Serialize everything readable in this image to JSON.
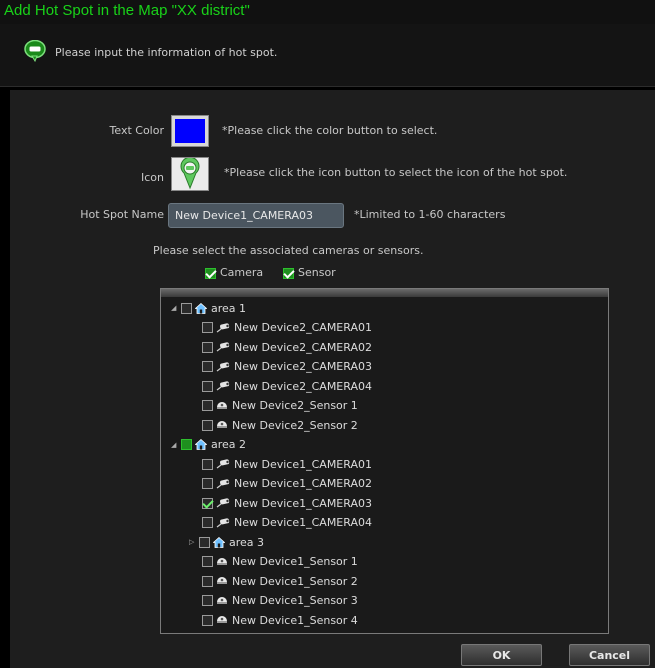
{
  "window": {
    "title": "Add Hot Spot in the Map \"XX district\""
  },
  "hint": {
    "text": "Please input the information of hot spot."
  },
  "form": {
    "text_color": {
      "label": "Text Color",
      "note": "*Please click the color button to select.",
      "value": "#0000ff"
    },
    "icon": {
      "label": "Icon",
      "note": "*Please click the icon button to select the icon of the hot spot."
    },
    "hot_spot_name": {
      "label": "Hot Spot Name",
      "value": "New Device1_CAMERA03",
      "note": "*Limited to 1-60 characters"
    },
    "assoc_prompt": "Please select the associated cameras or sensors.",
    "filters": [
      {
        "label": "Camera",
        "checked": true
      },
      {
        "label": "Sensor",
        "checked": true
      }
    ]
  },
  "tree": [
    {
      "label": "area 1",
      "type": "area",
      "level": 0,
      "expander": "expanded",
      "checked": false
    },
    {
      "label": "New Device2_CAMERA01",
      "type": "camera",
      "level": 1,
      "checked": false
    },
    {
      "label": "New Device2_CAMERA02",
      "type": "camera",
      "level": 1,
      "checked": false
    },
    {
      "label": "New Device2_CAMERA03",
      "type": "camera",
      "level": 1,
      "checked": false
    },
    {
      "label": "New Device2_CAMERA04",
      "type": "camera",
      "level": 1,
      "checked": false
    },
    {
      "label": "New Device2_Sensor 1",
      "type": "sensor",
      "level": 1,
      "checked": false
    },
    {
      "label": "New Device2_Sensor 2",
      "type": "sensor",
      "level": 1,
      "checked": false
    },
    {
      "label": "area 2",
      "type": "area",
      "level": 0,
      "expander": "expanded",
      "checked": "partial"
    },
    {
      "label": "New Device1_CAMERA01",
      "type": "camera",
      "level": 1,
      "checked": false
    },
    {
      "label": "New Device1_CAMERA02",
      "type": "camera",
      "level": 1,
      "checked": false
    },
    {
      "label": "New Device1_CAMERA03",
      "type": "camera",
      "level": 1,
      "checked": true
    },
    {
      "label": "New Device1_CAMERA04",
      "type": "camera",
      "level": 1,
      "checked": false
    },
    {
      "label": "area 3",
      "type": "area",
      "level": 1,
      "expander": "collapsed",
      "checked": false
    },
    {
      "label": "New Device1_Sensor 1",
      "type": "sensor",
      "level": 1,
      "checked": false
    },
    {
      "label": "New Device1_Sensor 2",
      "type": "sensor",
      "level": 1,
      "checked": false
    },
    {
      "label": "New Device1_Sensor 3",
      "type": "sensor",
      "level": 1,
      "checked": false
    },
    {
      "label": "New Device1_Sensor 4",
      "type": "sensor",
      "level": 1,
      "checked": false
    }
  ],
  "buttons": {
    "ok": "OK",
    "cancel": "Cancel"
  },
  "icons": {
    "hint": "speech-bubble-icon",
    "hot_spot": "map-pin-icon",
    "area": "house-icon",
    "camera": "camera-icon",
    "sensor": "sensor-icon"
  },
  "colors": {
    "title": "#19d219",
    "accent_green": "#2ec02e",
    "selected_color": "#0000ff"
  }
}
